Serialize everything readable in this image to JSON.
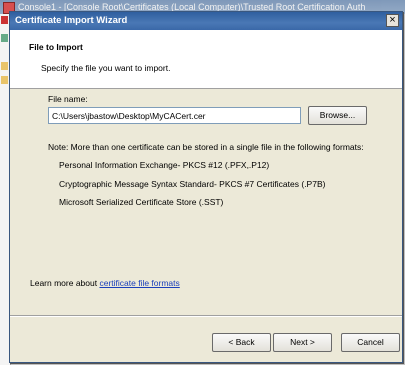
{
  "background_window": {
    "title": "Console1 - [Console Root\\Certificates (Local Computer)\\Trusted Root Certification Auth"
  },
  "dialog": {
    "title": "Certificate Import Wizard",
    "close_label": "×"
  },
  "header": {
    "title": "File to Import",
    "subtitle": "Specify the file you want to import."
  },
  "form": {
    "file_name_label": "File name:",
    "file_name_value": "C:\\Users\\jbastow\\Desktop\\MyCACert.cer",
    "browse_label": "Browse..."
  },
  "note": {
    "text": "Note:  More than one certificate can be stored in a single file in the following formats:",
    "formats": [
      "Personal Information Exchange- PKCS #12 (.PFX,.P12)",
      "Cryptographic Message Syntax Standard- PKCS #7 Certificates (.P7B)",
      "Microsoft Serialized Certificate Store (.SST)"
    ]
  },
  "learn_more": {
    "prefix": "Learn more about ",
    "link_text": "certificate file formats"
  },
  "buttons": {
    "back": "< Back",
    "next": "Next >",
    "cancel": "Cancel"
  },
  "colors": {
    "titlebar": "#3a68a8",
    "link": "#1a3fbb"
  }
}
